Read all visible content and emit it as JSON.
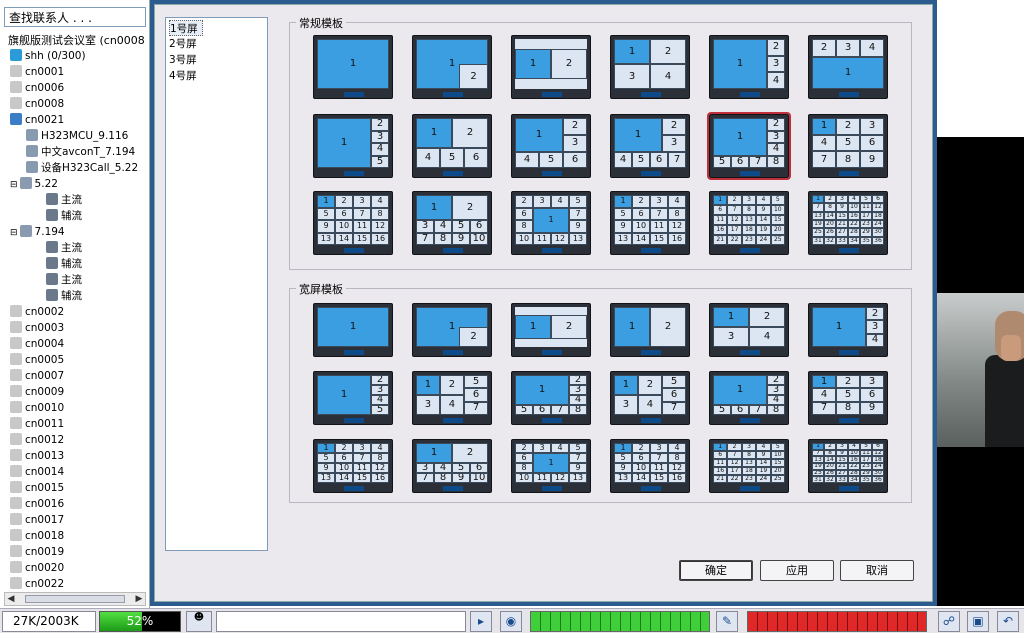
{
  "contacts": {
    "search_text": "查找联系人 . . .",
    "room_title": "旗舰版测试会议室 (cn0008",
    "nodes": [
      {
        "label": "shh (0/300)",
        "icon": "star-icon"
      },
      {
        "label": "cn0001",
        "icon": "user-icon"
      },
      {
        "label": "cn0006",
        "icon": "user-icon"
      },
      {
        "label": "cn0008",
        "icon": "user-icon"
      },
      {
        "label": "cn0021",
        "icon": "mp-icon"
      },
      {
        "label": "H323MCU_9.116",
        "icon": "h323-icon"
      },
      {
        "label": "中文avconT_7.194",
        "icon": "h323-icon"
      },
      {
        "label": "设备H323Call_5.22",
        "icon": "h323-icon"
      },
      {
        "label": "5.22",
        "icon": "h323-icon",
        "expand": "−"
      },
      {
        "label": "主流",
        "icon": "stream-icon"
      },
      {
        "label": "辅流",
        "icon": "stream-icon"
      },
      {
        "label": "7.194",
        "icon": "h323-icon",
        "expand": "−"
      },
      {
        "label": "主流",
        "icon": "stream-icon"
      },
      {
        "label": "辅流",
        "icon": "stream-icon"
      },
      {
        "label": "主流",
        "icon": "stream-icon"
      },
      {
        "label": "辅流",
        "icon": "stream-icon"
      },
      {
        "label": "cn0002",
        "icon": "user-icon"
      },
      {
        "label": "cn0003",
        "icon": "user-icon"
      },
      {
        "label": "cn0004",
        "icon": "user-icon"
      },
      {
        "label": "cn0005",
        "icon": "user-icon"
      },
      {
        "label": "cn0007",
        "icon": "user-icon"
      },
      {
        "label": "cn0009",
        "icon": "user-icon"
      },
      {
        "label": "cn0010",
        "icon": "user-icon"
      },
      {
        "label": "cn0011",
        "icon": "user-icon"
      },
      {
        "label": "cn0012",
        "icon": "user-icon"
      },
      {
        "label": "cn0013",
        "icon": "user-icon"
      },
      {
        "label": "cn0014",
        "icon": "user-icon"
      },
      {
        "label": "cn0015",
        "icon": "user-icon"
      },
      {
        "label": "cn0016",
        "icon": "user-icon"
      },
      {
        "label": "cn0017",
        "icon": "user-icon"
      },
      {
        "label": "cn0018",
        "icon": "user-icon"
      },
      {
        "label": "cn0019",
        "icon": "user-icon"
      },
      {
        "label": "cn0020",
        "icon": "user-icon"
      },
      {
        "label": "cn0022",
        "icon": "user-icon"
      }
    ]
  },
  "screens": {
    "items": [
      "1号屏",
      "2号屏",
      "3号屏",
      "4号屏"
    ],
    "selected": 0
  },
  "groups": {
    "standard": "常规模板",
    "wide": "宽屏模板"
  },
  "templates": {
    "standard": [
      "1",
      "1,2",
      "1-2s",
      "4",
      "1+3v",
      "1+3t",
      "1+4v",
      "2x2+4",
      "1+5",
      "1+6",
      "1+7",
      "3x3",
      "4x4",
      "1+12",
      "1+12b",
      "4x4b",
      "5x5",
      "6x6"
    ],
    "wide": [
      "1",
      "1,2",
      "1-2s",
      "1-2w",
      "2x2",
      "1+3v",
      "1+4v",
      "1+3m",
      "1+4b",
      "2x2+3",
      "1+7",
      "3x3",
      "4x4",
      "1+8w",
      "1+12b",
      "4x4",
      "5x5",
      "6x6"
    ],
    "selected_standard": 10
  },
  "buttons": {
    "ok": "确定",
    "apply": "应用",
    "cancel": "取消"
  },
  "statusbar": {
    "rate": "27K/2003K",
    "cpu": "52%",
    "cpu_value": 52
  }
}
